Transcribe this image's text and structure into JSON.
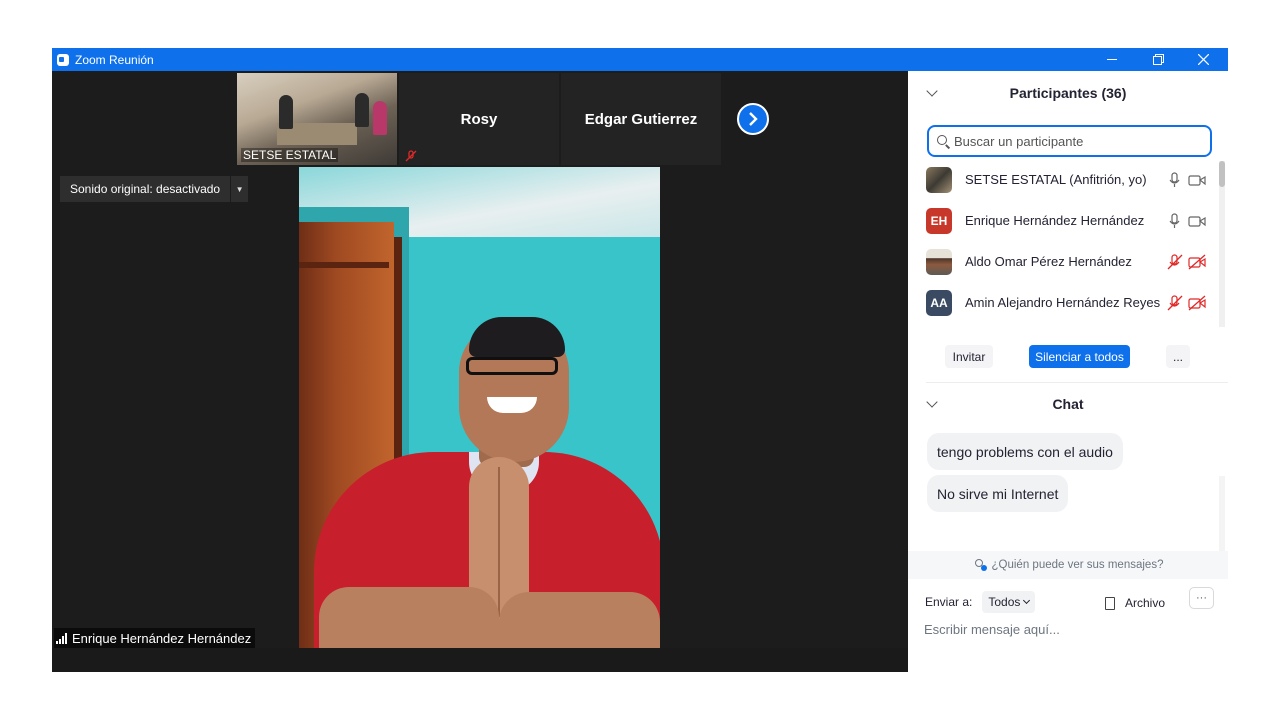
{
  "window": {
    "title": "Zoom Reunión",
    "controls": {
      "minimize": "—",
      "restore": "❐",
      "close": "✕"
    }
  },
  "strip": {
    "tiles": [
      {
        "name": "SETSE ESTATAL",
        "kind": "video",
        "muted": true
      },
      {
        "name": "Rosy",
        "kind": "name",
        "muted": true
      },
      {
        "name": "Edgar Gutierrez",
        "kind": "name",
        "muted": false
      }
    ]
  },
  "video": {
    "sound_button": "Sonido original: desactivado",
    "speaker_name": "Enrique Hernández Hernández"
  },
  "participants": {
    "header": "Participantes (36)",
    "search_placeholder": "Buscar un participante",
    "list": [
      {
        "name": "SETSE ESTATAL (Anfitrión, yo)",
        "avatar": "photo",
        "mic": "on",
        "cam": "on"
      },
      {
        "name": "Enrique Hernández Hernández",
        "avatar": "EH",
        "avatar_color": "#c8382a",
        "mic": "on",
        "cam": "on"
      },
      {
        "name": "Aldo Omar Pérez Hernández",
        "avatar": "photo",
        "mic": "off",
        "cam": "off"
      },
      {
        "name": "Amin Alejandro Hernández Reyes",
        "avatar": "AA",
        "avatar_color": "#3a4a63",
        "mic": "off",
        "cam": "off"
      }
    ],
    "buttons": {
      "invite": "Invitar",
      "mute_all": "Silenciar a todos",
      "more": "..."
    }
  },
  "chat": {
    "header": "Chat",
    "messages": [
      "tengo problems con el audio",
      "No sirve mi Internet"
    ],
    "privacy_note": "¿Quién puede ver sus mensajes?",
    "send_to_label": "Enviar a:",
    "send_to_value": "Todos",
    "file_label": "Archivo",
    "more_label": "···",
    "input_placeholder": "Escribir mensaje aquí..."
  },
  "colors": {
    "accent": "#0e71eb",
    "muted_red": "#e02828"
  }
}
